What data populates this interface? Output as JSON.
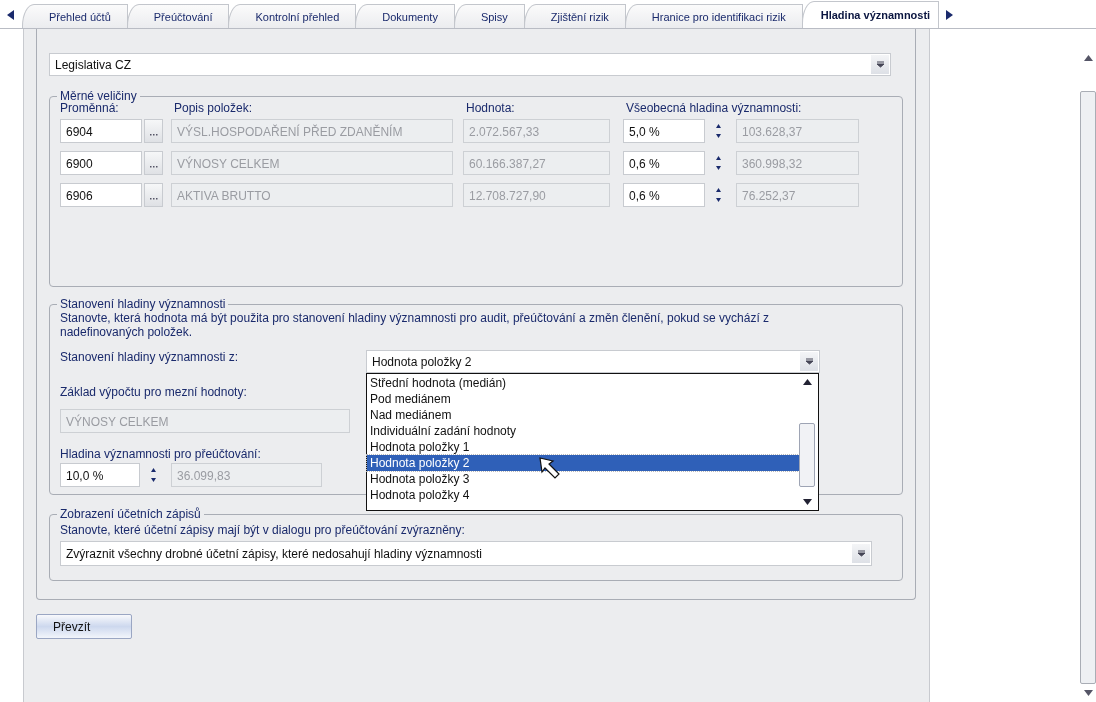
{
  "tabs": [
    {
      "label": "Přehled účtů",
      "selected": false
    },
    {
      "label": "Přeúčtování",
      "selected": false
    },
    {
      "label": "Kontrolní přehled",
      "selected": false
    },
    {
      "label": "Dokumenty",
      "selected": false
    },
    {
      "label": "Spisy",
      "selected": false
    },
    {
      "label": "Zjištění rizik",
      "selected": false
    },
    {
      "label": "Hranice pro identifikaci rizik",
      "selected": false
    },
    {
      "label": "Hladina významnosti",
      "selected": true
    }
  ],
  "legislation": {
    "value": "Legislativa CZ"
  },
  "measures": {
    "title": "Měrné veličiny",
    "columns": [
      "Proměnná:",
      "Popis položek:",
      "Hodnota:",
      "Všeobecná hladina významnosti:"
    ],
    "rows": [
      {
        "variable": "6904",
        "description": "VÝSL.HOSPODAŘENÍ PŘED ZDANĚNÍM",
        "value": "2.072.567,33",
        "percent": "5,0 %",
        "amount": "103.628,37"
      },
      {
        "variable": "6900",
        "description": "VÝNOSY CELKEM",
        "value": "60.166.387,27",
        "percent": "0,6 %",
        "amount": "360.998,32"
      },
      {
        "variable": "6906",
        "description": "AKTIVA BRUTTO",
        "value": "12.708.727,90",
        "percent": "0,6 %",
        "amount": "76.252,37"
      }
    ]
  },
  "significance": {
    "title": "Stanovení hladiny významnosti",
    "description": "Stanovte, která hodnota má být použita pro stanovení hladiny významnosti pro audit, přeúčtování a změn členění, pokud se vychází z nadefinovaných položek.",
    "source_label": "Stanovení hladiny významnosti z:",
    "source_value": "Hodnota položky 2",
    "options": [
      {
        "label": "Střední hodnota  (medián)",
        "selected": false
      },
      {
        "label": "Pod mediánem",
        "selected": false
      },
      {
        "label": "Nad mediánem",
        "selected": false
      },
      {
        "label": "Individuální zadání hodnoty",
        "selected": false
      },
      {
        "label": "Hodnota položky 1",
        "selected": false
      },
      {
        "label": "Hodnota položky 2",
        "selected": true
      },
      {
        "label": "Hodnota položky 3",
        "selected": false
      },
      {
        "label": "Hodnota položky 4",
        "selected": false
      }
    ],
    "base_label": "Základ výpočtu pro mezní hodnoty:",
    "base_value": "VÝNOSY CELKEM",
    "rework_label": "Hladina významnosti pro přeúčtování:",
    "rework_percent": "10,0 %",
    "rework_amount": "36.099,83"
  },
  "entries": {
    "title": "Zobrazení účetních zápisů",
    "label": "Stanovte, které účetní zápisy mají být v dialogu pro přeúčtování zvýrazněny:",
    "value": "Zvýraznit všechny drobné účetní zápisy, které nedosahují hladiny významnosti"
  },
  "button": "Převzít"
}
